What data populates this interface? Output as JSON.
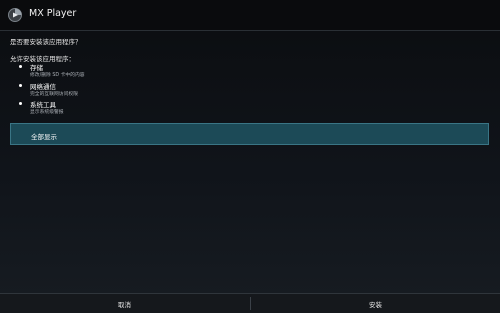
{
  "dialog": {
    "app_title": "MX Player",
    "app_icon": "mx-player-app-icon",
    "question": "是否要安装该应用程序？",
    "permissions_label": "允许安装该应用程序：",
    "permissions": [
      {
        "title": "存储",
        "description": "修改/删除 SD 卡中的内容"
      },
      {
        "title": "网络通信",
        "description": "完全的互联网访问权限"
      },
      {
        "title": "系统工具",
        "description": "显示系统级警报"
      }
    ],
    "show_all_label": "全部显示",
    "cancel_label": "取消",
    "install_label": "安装"
  },
  "colors": {
    "accent": "#1c4a57",
    "background": "#0d0f12"
  }
}
